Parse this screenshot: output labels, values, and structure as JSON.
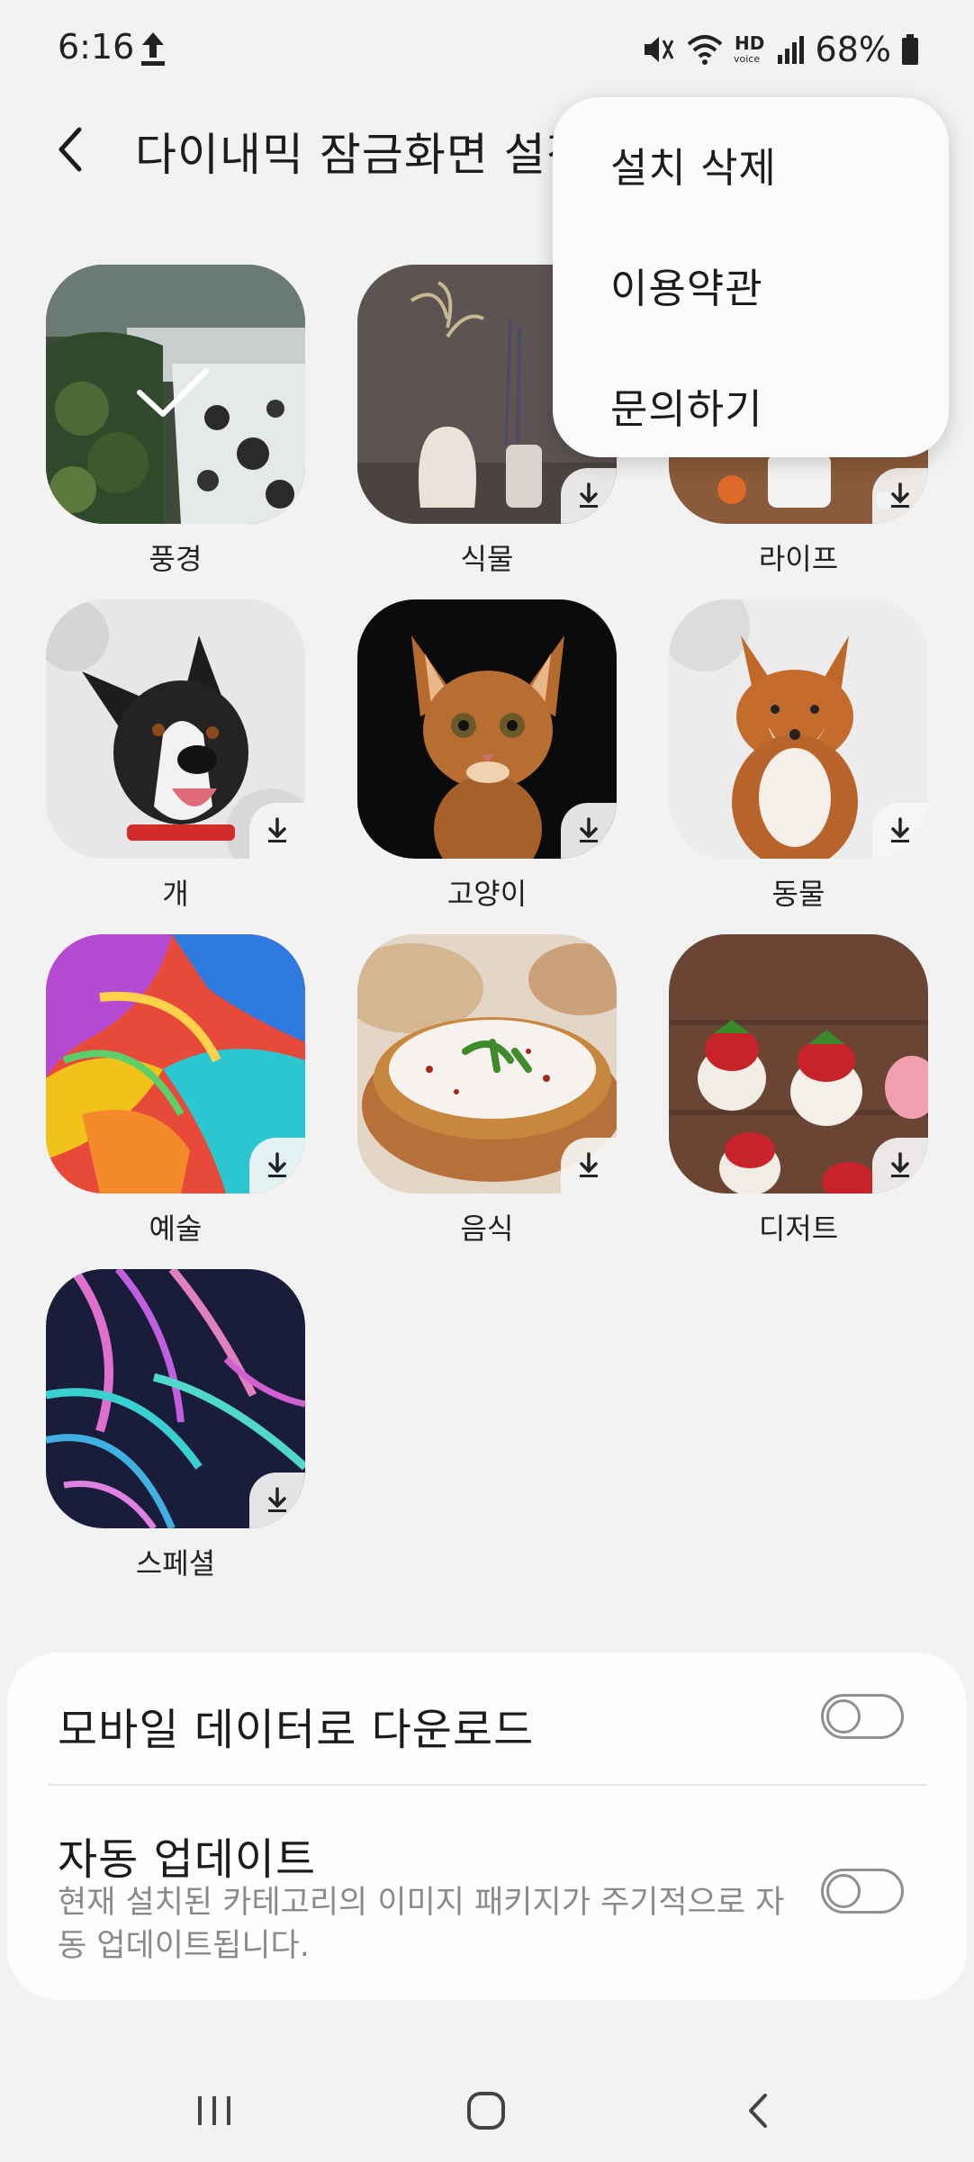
{
  "status_bar": {
    "time": "6:16",
    "battery": "68%"
  },
  "header": {
    "title": "다이내믹 잠금화면 설정"
  },
  "categories": [
    {
      "label": "풍경",
      "selected": true
    },
    {
      "label": "식물",
      "selected": false
    },
    {
      "label": "라이프",
      "selected": false
    },
    {
      "label": "개",
      "selected": false
    },
    {
      "label": "고양이",
      "selected": false
    },
    {
      "label": "동물",
      "selected": false
    },
    {
      "label": "예술",
      "selected": false
    },
    {
      "label": "음식",
      "selected": false
    },
    {
      "label": "디저트",
      "selected": false
    },
    {
      "label": "스페셜",
      "selected": false
    }
  ],
  "settings": {
    "mobile_data": {
      "label": "모바일 데이터로 다운로드",
      "enabled": false
    },
    "auto_update": {
      "label": "자동 업데이트",
      "description": "현재 설치된 카테고리의 이미지 패키지가 주기적으로 자동 업데이트됩니다.",
      "enabled": false
    }
  },
  "menu": {
    "items": [
      "설치 삭제",
      "이용약관",
      "문의하기"
    ]
  },
  "colors": {
    "background": "#f2f2f2",
    "card": "#fdfdfd",
    "toggle_off": "#8f8f8f"
  }
}
